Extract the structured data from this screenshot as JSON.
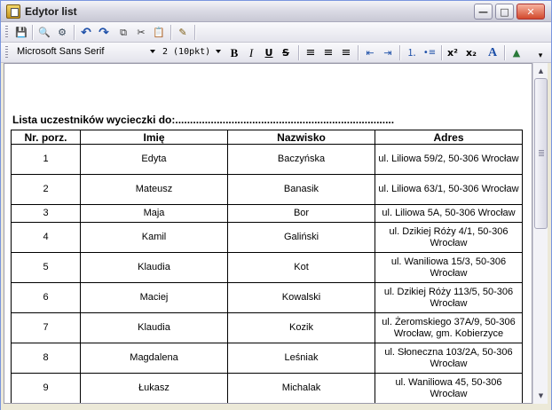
{
  "window": {
    "title": "Edytor list",
    "min_glyph": "—",
    "max_glyph": "□",
    "close_glyph": "✕"
  },
  "toolbar_main": {
    "buttons": [
      {
        "name": "save-icon",
        "glyph": "💾"
      },
      {
        "name": "find-icon",
        "glyph": "🔍"
      },
      {
        "name": "replace-icon",
        "glyph": "⚙"
      },
      {
        "name": "undo-icon",
        "glyph": "↶"
      },
      {
        "name": "redo-icon",
        "glyph": "↷"
      },
      {
        "name": "copy-icon",
        "glyph": "⧉"
      },
      {
        "name": "cut-icon",
        "glyph": "✂"
      },
      {
        "name": "paste-icon",
        "glyph": "📋"
      },
      {
        "name": "edit-document-icon",
        "glyph": "✎"
      }
    ]
  },
  "toolbar_format": {
    "font_name": "Microsoft Sans Serif",
    "font_size": "2 (10pkt)",
    "bold": "B",
    "italic": "I",
    "underline": "U",
    "strike": "S",
    "align_left": "≡",
    "align_center": "≡",
    "align_right": "≡",
    "outdent": "⇤",
    "indent": "⇥",
    "numbered_list": "⒈",
    "bullet_list": "•≡",
    "superscript": "x²",
    "subscript": "x₂",
    "font_color": "A",
    "insert_image": "▲",
    "overflow": "▾"
  },
  "document": {
    "heading": "Lista uczestników wycieczki do:..........................................................................",
    "columns": [
      "Nr. porz.",
      "Imię",
      "Nazwisko",
      "Adres"
    ],
    "rows": [
      {
        "nr": "1",
        "imie": "Edyta",
        "nazwisko": "Baczyńska",
        "adres": "ul. Liliowa 59/2, 50-306 Wrocław"
      },
      {
        "nr": "2",
        "imie": "Mateusz",
        "nazwisko": "Banasik",
        "adres": "ul. Liliowa 63/1, 50-306 Wrocław"
      },
      {
        "nr": "3",
        "imie": "Maja",
        "nazwisko": "Bor",
        "adres": "ul. Liliowa 5A, 50-306 Wrocław"
      },
      {
        "nr": "4",
        "imie": "Kamil",
        "nazwisko": "Galiński",
        "adres": "ul. Dzikiej Róży 4/1, 50-306 Wrocław"
      },
      {
        "nr": "5",
        "imie": "Klaudia",
        "nazwisko": "Kot",
        "adres": "ul. Waniliowa 15/3, 50-306 Wrocław"
      },
      {
        "nr": "6",
        "imie": "Maciej",
        "nazwisko": "Kowalski",
        "adres": "ul. Dzikiej Róży 113/5, 50-306 Wrocław"
      },
      {
        "nr": "7",
        "imie": "Klaudia",
        "nazwisko": "Kozik",
        "adres": "ul. Żeromskiego 37A/9, 50-306 Wrocław, gm. Kobierzyce"
      },
      {
        "nr": "8",
        "imie": "Magdalena",
        "nazwisko": "Leśniak",
        "adres": "ul. Słoneczna 103/2A, 50-306 Wrocław"
      },
      {
        "nr": "9",
        "imie": "Łukasz",
        "nazwisko": "Michalak",
        "adres": "ul. Waniliowa 45, 50-306 Wrocław"
      }
    ]
  },
  "scrollbar": {
    "up": "▲",
    "down": "▼"
  }
}
